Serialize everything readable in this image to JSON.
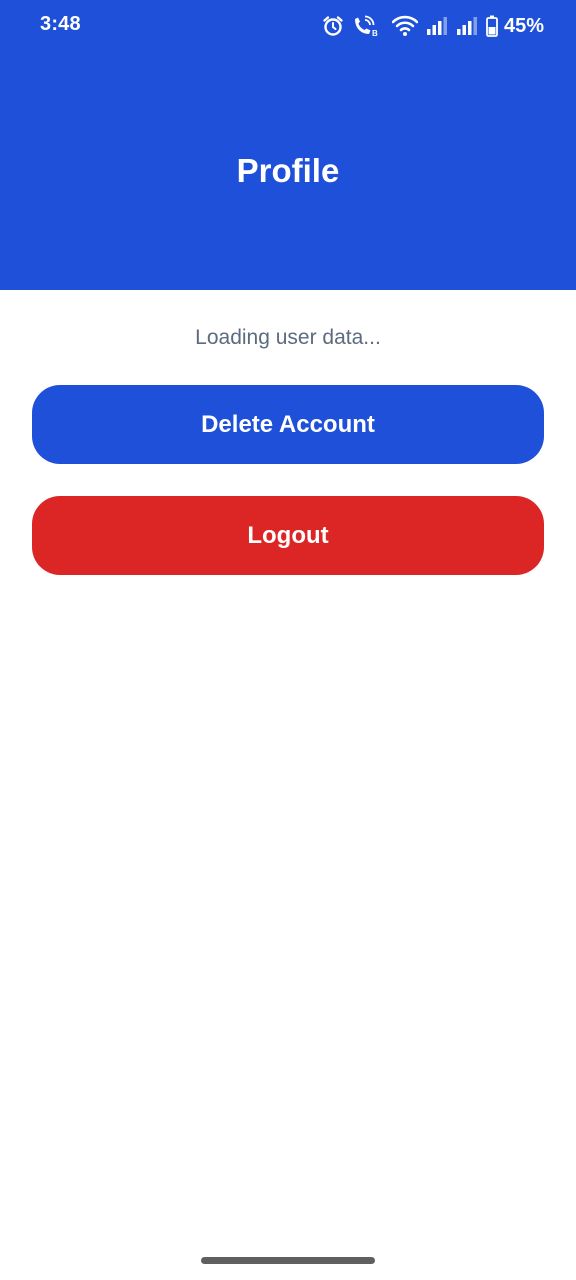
{
  "status_bar": {
    "time": "3:48",
    "battery_percent": "45%",
    "icons": [
      "alarm-icon",
      "wifi-calling-icon",
      "wifi-icon",
      "signal-icon",
      "signal-icon",
      "battery-icon"
    ]
  },
  "header": {
    "title": "Profile"
  },
  "main": {
    "loading_text": "Loading user data...",
    "delete_label": "Delete Account",
    "logout_label": "Logout"
  },
  "colors": {
    "primary": "#1e50d9",
    "danger": "#dc2626",
    "muted_text": "#5c6b80"
  }
}
